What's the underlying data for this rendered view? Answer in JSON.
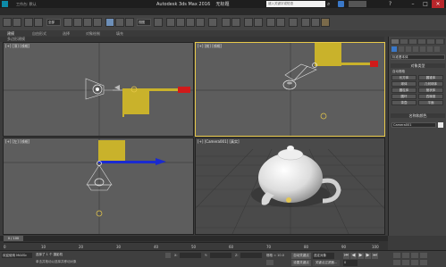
{
  "window": {
    "title": "Autodesk 3ds Max 2016",
    "file_name": "无标题",
    "search_placeholder": "键入关键字或短语"
  },
  "toolbar": {
    "workspace_label": "工作台: 默认",
    "selection_filter": "全部",
    "view_label": "视图"
  },
  "ribbon": {
    "items": [
      "建模",
      "自由形式",
      "选择",
      "对象绘制",
      "填充"
    ],
    "sub_items": [
      "多边形建模"
    ]
  },
  "viewports": [
    {
      "id": "top",
      "label": "[+] [顶] [线框]"
    },
    {
      "id": "front",
      "label": "[+] [前] [线框]"
    },
    {
      "id": "left",
      "label": "[+] [左] [线框]"
    },
    {
      "id": "camera",
      "label": "[+] [Camera001] [真实]"
    }
  ],
  "command_panel": {
    "dropdown_value": "标准基本体",
    "rollout_object_type": "对象类型",
    "auto_grid": "自动栅格",
    "buttons": [
      "长方体",
      "圆锥体",
      "球体",
      "几何球体",
      "圆柱体",
      "管状体",
      "圆环",
      "四棱锥",
      "茶壶",
      "平面"
    ],
    "rollout_name_color": "名称和颜色",
    "name_value": "Camera001"
  },
  "timeline": {
    "position": "0 / 100",
    "ticks": [
      "0",
      "10",
      "20",
      "30",
      "40",
      "50",
      "60",
      "70",
      "80",
      "90",
      "100"
    ]
  },
  "status": {
    "welcome": "欢迎使用 MAXSc",
    "selected": "选择了 1 个 摄影机",
    "hint": "单击并拖动以选择并移动对象",
    "x": "X:",
    "y": "Y:",
    "z": "Z:",
    "grid": "栅格 = 10.0",
    "auto_key": "自动关键点",
    "set_key": "设置关键点",
    "key_filter": "关键点过滤器...",
    "selected_obj": "选定对象",
    "frame": "0"
  },
  "colors": {
    "active_border": "#e8c94a",
    "light_box": "#c9b22b",
    "axis_red": "#d01a1a",
    "axis_blue": "#1a2ad0",
    "accent_blue": "#3a78c8"
  }
}
